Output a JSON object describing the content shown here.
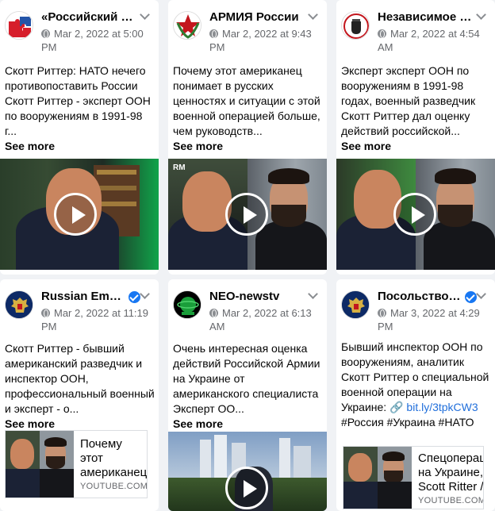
{
  "posts": [
    {
      "page_name": "«Российский с...",
      "timestamp": "Mar 2, 2022 at 5:00 PM",
      "text": "Скотт Риттер: НАТО нечего противопоставить России Скотт Риттер - эксперт ООН по вооружениям в 1991-98 г...",
      "see_more": "See more",
      "avatar_icon": "puzzle-logo-icon"
    },
    {
      "page_name": "АРМИЯ России",
      "timestamp": "Mar 2, 2022 at 9:43 PM",
      "text": "Почему этот американец понимает в русских ценностях и ситуации с этой военной операцией больше, чем руководств...",
      "see_more": "See more",
      "video_badge": "RM",
      "avatar_icon": "army-star-logo-icon"
    },
    {
      "page_name": "Независимое \"...",
      "timestamp": "Mar 2, 2022 at 4:54 AM",
      "text": "Эксперт эксперт ООН по вооружениям в 1991-98 годах, военный разведчик Скотт Риттер дал оценку действий российской...",
      "see_more": "See more",
      "avatar_icon": "fist-logo-icon"
    },
    {
      "page_name": "Russian Emba...",
      "verified": true,
      "timestamp": "Mar 2, 2022 at 11:19 PM",
      "text": "Скотт Риттер - бывший американский разведчик и инспектор ООН, профессиональный военный и эксперт - о...",
      "see_more": "See more",
      "link_title": "Почему этот американец",
      "link_domain": "YOUTUBE.COM",
      "avatar_icon": "coat-of-arms-icon"
    },
    {
      "page_name": "NEO-newstv",
      "timestamp": "Mar 2, 2022 at 6:13 AM",
      "text": "Очень интересная оценка действий Российской Армии на Украине от американского специалиста Эксперт ОО...",
      "see_more": "See more",
      "avatar_icon": "neo-logo-icon"
    },
    {
      "page_name": "Посольство Р...",
      "verified": true,
      "timestamp": "Mar 3, 2022 at 4:29 PM",
      "text_lead": "Бывший инспектор ООН по вооружениям, аналитик Скотт Риттер о специальной военной операции на Украине:",
      "link_emoji": "🔗",
      "short_link": "bit.ly/3tpkCW3",
      "hashtags": "#Россия #Украина #НАТО",
      "link_title": "Спецоперац на Украине, Scott Ritter /",
      "link_domain": "YOUTUBE.COM",
      "avatar_icon": "coat-of-arms-icon"
    }
  ],
  "colors": {
    "verified": "#1877f2",
    "link": "#216fdb",
    "meta": "#65676b"
  }
}
